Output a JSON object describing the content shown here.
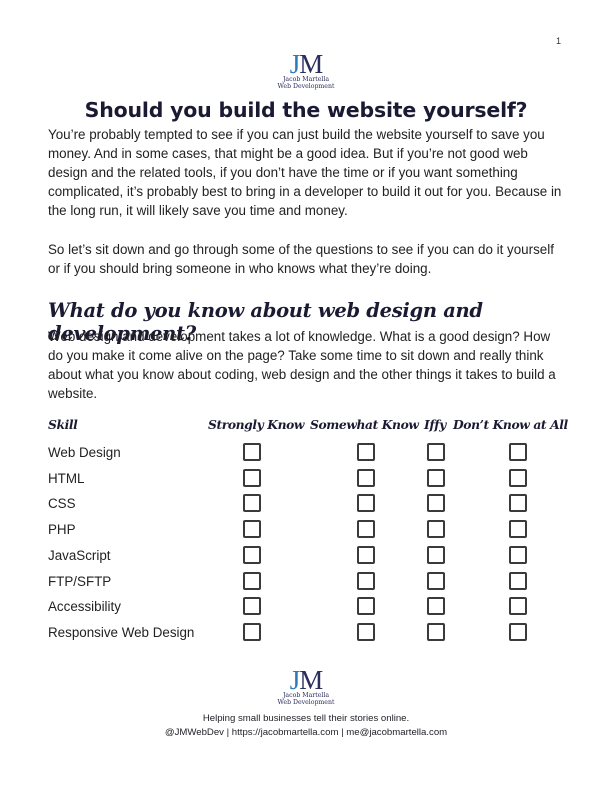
{
  "page_number": "1",
  "logo": {
    "mark_j": "J",
    "mark_m": "M",
    "line1": "Jacob Martella",
    "line2": "Web Development",
    "colors": {
      "j": "#2f79b9",
      "m": "#2b2d5c"
    }
  },
  "title": "Should you build the website yourself?",
  "intro_paragraphs": [
    "You’re probably tempted to see if you can just build the website yourself to save you money. And in some cases, that might be a good idea. But if you’re not good web design and the related tools, if you don’t have the time or if you want something complicated, it’s probably best to bring in a developer to build it out for you. Because in the long run, it will likely save you time and money.",
    "So let’s sit down and go through some of the questions to see if you can do it yourself or if you should bring someone in who knows what they’re doing."
  ],
  "section": {
    "heading": "What do you know about web design and development?",
    "paragraph": "Web design and development takes a lot of knowledge. What is a good design? How do you make it come alive on the page? Take some time to sit down and really think about what you know about coding, web design and the other things it takes to build a website."
  },
  "table": {
    "headers": [
      "Skill",
      "Strongly Know",
      "Somewhat Know",
      "Iffy",
      "Don’t Know at All"
    ],
    "rows": [
      {
        "skill": "Web Design",
        "checked": [
          false,
          false,
          false,
          false
        ]
      },
      {
        "skill": "HTML",
        "checked": [
          false,
          false,
          false,
          false
        ]
      },
      {
        "skill": "CSS",
        "checked": [
          false,
          false,
          false,
          false
        ]
      },
      {
        "skill": "PHP",
        "checked": [
          false,
          false,
          false,
          false
        ]
      },
      {
        "skill": "JavaScript",
        "checked": [
          false,
          false,
          false,
          false
        ]
      },
      {
        "skill": "FTP/SFTP",
        "checked": [
          false,
          false,
          false,
          false
        ]
      },
      {
        "skill": "Accessibility",
        "checked": [
          false,
          false,
          false,
          false
        ]
      },
      {
        "skill": "Responsive Web Design",
        "checked": [
          false,
          false,
          false,
          false
        ]
      }
    ]
  },
  "footer": {
    "tagline": "Helping small businesses tell their stories online.",
    "contact": "@JMWebDev | https://jacobmartella.com | me@jacobmartella.com"
  }
}
